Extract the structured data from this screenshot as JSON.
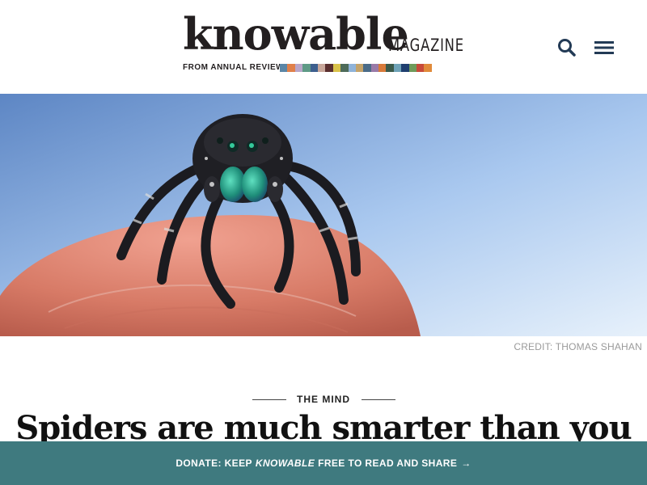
{
  "header": {
    "logo": {
      "word": "knowable",
      "magazine": "MAGAZINE",
      "from": "FROM ANNUAL REVIEWS",
      "strip_colors": [
        "#5b86a6",
        "#e0804a",
        "#b9a6c9",
        "#5e9a86",
        "#3d5f8e",
        "#c8a79a",
        "#5a2f2f",
        "#d9c24a",
        "#4d6b5a",
        "#8fb3d9",
        "#c4a36a",
        "#4a6b88",
        "#9a7aa8",
        "#d87a3a",
        "#3b5a4a",
        "#6fa3b8",
        "#1f3f6f",
        "#6f9a5a",
        "#c84a3a",
        "#e08a3a"
      ]
    },
    "search_icon": "search-icon",
    "menu_icon": "hamburger-menu-icon"
  },
  "hero": {
    "alt": "Jumping spider on fingertip",
    "credit": "CREDIT: THOMAS SHAHAN"
  },
  "article": {
    "category": "THE MIND",
    "headline": "Spiders are much smarter than you"
  },
  "donate": {
    "prefix": "DONATE: KEEP",
    "brand": "KNOWABLE",
    "suffix": "FREE TO READ AND SHARE",
    "arrow": "→",
    "color": "#3f7a7f"
  }
}
